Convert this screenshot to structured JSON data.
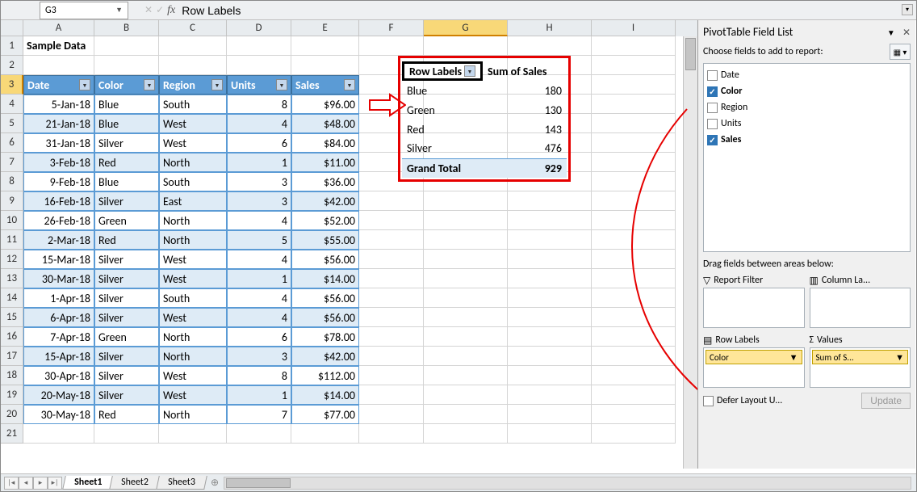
{
  "name_box": "G3",
  "formula_value": "Row Labels",
  "columns": [
    "A",
    "B",
    "C",
    "D",
    "E",
    "F",
    "G",
    "H",
    "I"
  ],
  "selected_col": "G",
  "selected_row": 3,
  "row_count": 21,
  "title_cell": "Sample Data",
  "table_headers": [
    "Date",
    "Color",
    "Region",
    "Units",
    "Sales"
  ],
  "table_rows": [
    [
      "5-Jan-18",
      "Blue",
      "South",
      "8",
      "$96.00"
    ],
    [
      "21-Jan-18",
      "Blue",
      "West",
      "4",
      "$48.00"
    ],
    [
      "31-Jan-18",
      "Silver",
      "West",
      "6",
      "$84.00"
    ],
    [
      "3-Feb-18",
      "Red",
      "North",
      "1",
      "$11.00"
    ],
    [
      "9-Feb-18",
      "Blue",
      "South",
      "3",
      "$36.00"
    ],
    [
      "16-Feb-18",
      "Silver",
      "East",
      "3",
      "$42.00"
    ],
    [
      "26-Feb-18",
      "Green",
      "North",
      "4",
      "$52.00"
    ],
    [
      "2-Mar-18",
      "Red",
      "North",
      "5",
      "$55.00"
    ],
    [
      "15-Mar-18",
      "Silver",
      "West",
      "4",
      "$56.00"
    ],
    [
      "30-Mar-18",
      "Silver",
      "West",
      "1",
      "$14.00"
    ],
    [
      "1-Apr-18",
      "Silver",
      "South",
      "4",
      "$56.00"
    ],
    [
      "6-Apr-18",
      "Silver",
      "West",
      "4",
      "$56.00"
    ],
    [
      "7-Apr-18",
      "Green",
      "North",
      "6",
      "$78.00"
    ],
    [
      "15-Apr-18",
      "Silver",
      "North",
      "3",
      "$42.00"
    ],
    [
      "30-Apr-18",
      "Silver",
      "West",
      "8",
      "$112.00"
    ],
    [
      "20-May-18",
      "Silver",
      "West",
      "1",
      "$14.00"
    ],
    [
      "30-May-18",
      "Red",
      "North",
      "7",
      "$77.00"
    ]
  ],
  "pivot": {
    "header_row": "Row Labels",
    "header_sum": "Sum of Sales",
    "rows": [
      [
        "Blue",
        "180"
      ],
      [
        "Green",
        "130"
      ],
      [
        "Red",
        "143"
      ],
      [
        "Silver",
        "476"
      ]
    ],
    "total_label": "Grand Total",
    "total_value": "929"
  },
  "fieldlist": {
    "title": "PivotTable Field List",
    "subtitle": "Choose fields to add to report:",
    "fields": [
      {
        "name": "Date",
        "checked": false
      },
      {
        "name": "Color",
        "checked": true
      },
      {
        "name": "Region",
        "checked": false
      },
      {
        "name": "Units",
        "checked": false
      },
      {
        "name": "Sales",
        "checked": true
      }
    ],
    "drag_label": "Drag fields between areas below:",
    "areas": {
      "report_filter": "Report Filter",
      "column_labels": "Column La...",
      "row_labels": "Row Labels",
      "values": "Values"
    },
    "row_field": "Color",
    "value_field": "Sum of S...",
    "defer": "Defer Layout U...",
    "update": "Update"
  },
  "sheets": [
    "Sheet1",
    "Sheet2",
    "Sheet3"
  ],
  "active_sheet": 0
}
